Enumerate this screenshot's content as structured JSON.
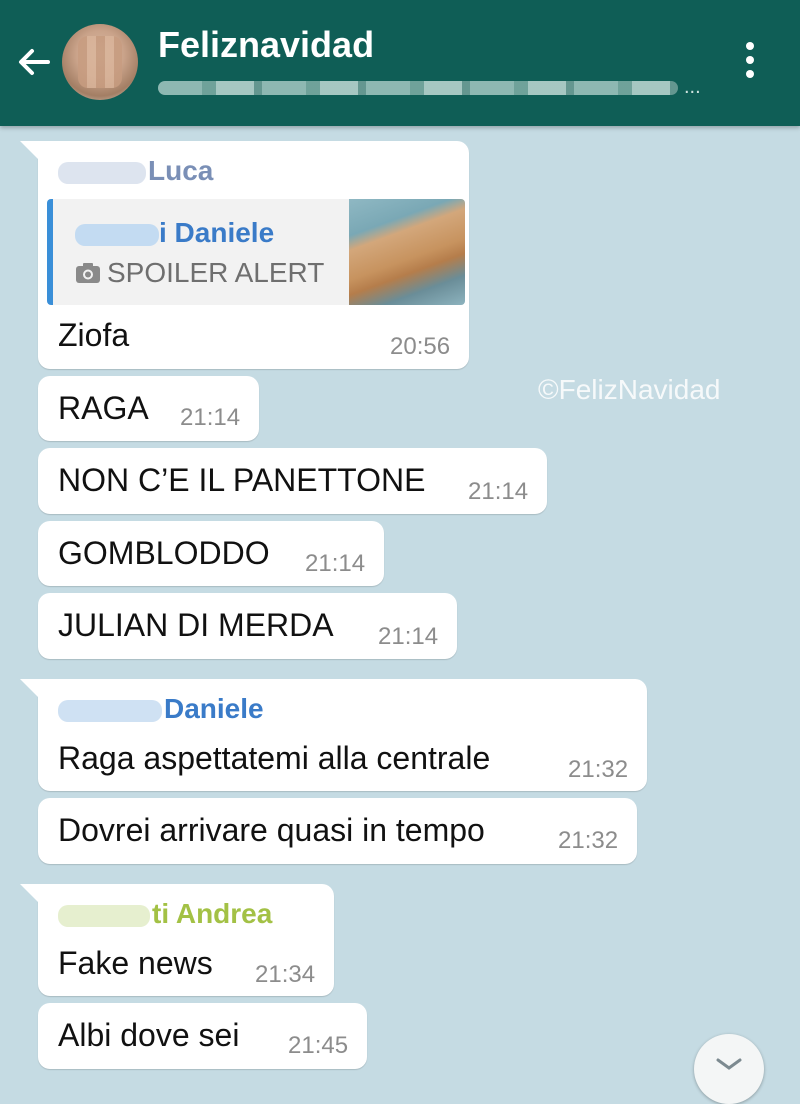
{
  "header": {
    "title": "Feliznavidad",
    "subtitle_suffix": "...",
    "colors": {
      "bar": "#0f5e56"
    },
    "icons": {
      "back": "arrow-left-icon",
      "menu": "more-vertical-icon"
    }
  },
  "watermark": "©FelizNavidad",
  "messages": [
    {
      "sender_name": "Luca",
      "reply": {
        "name": "i Daniele",
        "text": "SPOILER ALERT",
        "icon": "camera-icon"
      },
      "text": "Ziofa",
      "time": "20:56"
    },
    {
      "text": "RAGA",
      "time": "21:14"
    },
    {
      "text": "NON C’E IL PANETTONE",
      "time": "21:14"
    },
    {
      "text": "GOMBLODDO",
      "time": "21:14"
    },
    {
      "text": "JULIAN DI MERDA",
      "time": "21:14"
    },
    {
      "sender_name": "Daniele",
      "text": "Raga aspettatemi alla centrale",
      "time": "21:32"
    },
    {
      "text": "Dovrei arrivare quasi in tempo",
      "time": "21:32"
    },
    {
      "sender_name": "ti Andrea",
      "text": "Fake news",
      "time": "21:34"
    },
    {
      "text": "Albi dove sei",
      "time": "21:45"
    }
  ],
  "sender_colors": {
    "luca": "#7a8fb6",
    "daniele": "#3a7bc8",
    "andrea": "#a3c145"
  },
  "scroll_icon": "chevron-down-icon"
}
